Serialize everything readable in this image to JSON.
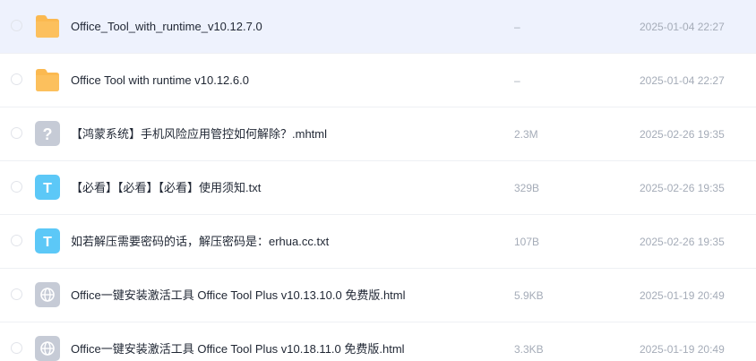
{
  "files": [
    {
      "name": "Office_Tool_with_runtime_v10.12.7.0",
      "size": "–",
      "modified": "2025-01-04 22:27",
      "icon": "folder-icon",
      "selected": true
    },
    {
      "name": "Office Tool with runtime v10.12.6.0",
      "size": "–",
      "modified": "2025-01-04 22:27",
      "icon": "folder-icon",
      "selected": false
    },
    {
      "name": "【鸿蒙系统】手机风险应用管控如何解除？.mhtml",
      "size": "2.3M",
      "modified": "2025-02-26 19:35",
      "icon": "unknown-file-icon",
      "selected": false
    },
    {
      "name": "【必看】【必看】【必看】使用须知.txt",
      "size": "329B",
      "modified": "2025-02-26 19:35",
      "icon": "text-file-icon",
      "selected": false
    },
    {
      "name": "如若解压需要密码的话，解压密码是：erhua.cc.txt",
      "size": "107B",
      "modified": "2025-02-26 19:35",
      "icon": "text-file-icon",
      "selected": false
    },
    {
      "name": "Office一键安装激活工具 Office Tool Plus v10.13.10.0 免费版.html",
      "size": "5.9KB",
      "modified": "2025-01-19 20:49",
      "icon": "web-file-icon",
      "selected": false
    },
    {
      "name": "Office一键安装激活工具 Office Tool Plus v10.18.11.0 免费版.html",
      "size": "3.3KB",
      "modified": "2025-01-19 20:49",
      "icon": "web-file-icon",
      "selected": false
    }
  ],
  "icon_glyphs": {
    "unknown": "?",
    "text": "T"
  },
  "colors": {
    "selected_row": "#eef2fd",
    "folder": "#fbb950",
    "text_icon": "#5cc8f7",
    "unknown_icon": "#c6cbd6",
    "web_icon": "#c6cbd6"
  }
}
